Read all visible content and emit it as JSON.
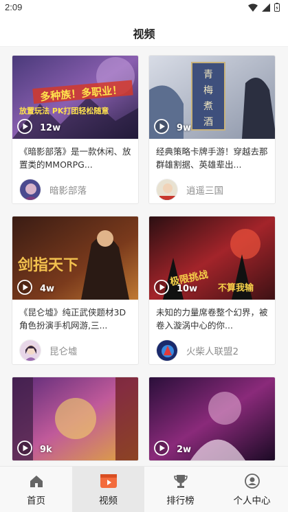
{
  "status": {
    "time": "2:09"
  },
  "header": {
    "title": "视频"
  },
  "videos": [
    {
      "views": "12w",
      "description": "《暗影部落》是一款休闲、放置类的MMORPG...",
      "author": "暗影部落",
      "banner_text": "多种族！多职业！",
      "banner_sub": "放置玩法 PK打团轻松随意"
    },
    {
      "views": "9w",
      "description": "经典策略卡牌手游！穿越去那群雄割据、英雄辈出...",
      "author": "逍遥三国",
      "banner_text": "青梅煮酒"
    },
    {
      "views": "4w",
      "description": "《昆仑墟》纯正武侠题材3D角色扮演手机网游,三...",
      "author": "昆仑墟",
      "banner_text": "剑指天下"
    },
    {
      "views": "10w",
      "description": "未知的力量席卷整个幻界，被卷入漩涡中心的你...",
      "author": "火柴人联盟2",
      "banner_text": "极限挑战",
      "banner_sub": "不算我输"
    },
    {
      "views": "9k",
      "description": "",
      "author": ""
    },
    {
      "views": "2w",
      "description": "",
      "author": ""
    }
  ],
  "tabs": [
    {
      "label": "首页",
      "icon": "home-icon"
    },
    {
      "label": "视频",
      "icon": "video-icon",
      "active": true
    },
    {
      "label": "排行榜",
      "icon": "trophy-icon"
    },
    {
      "label": "个人中心",
      "icon": "user-icon"
    }
  ],
  "colors": {
    "accent": "#f36b3c",
    "muted_text": "#8d8d8d"
  }
}
